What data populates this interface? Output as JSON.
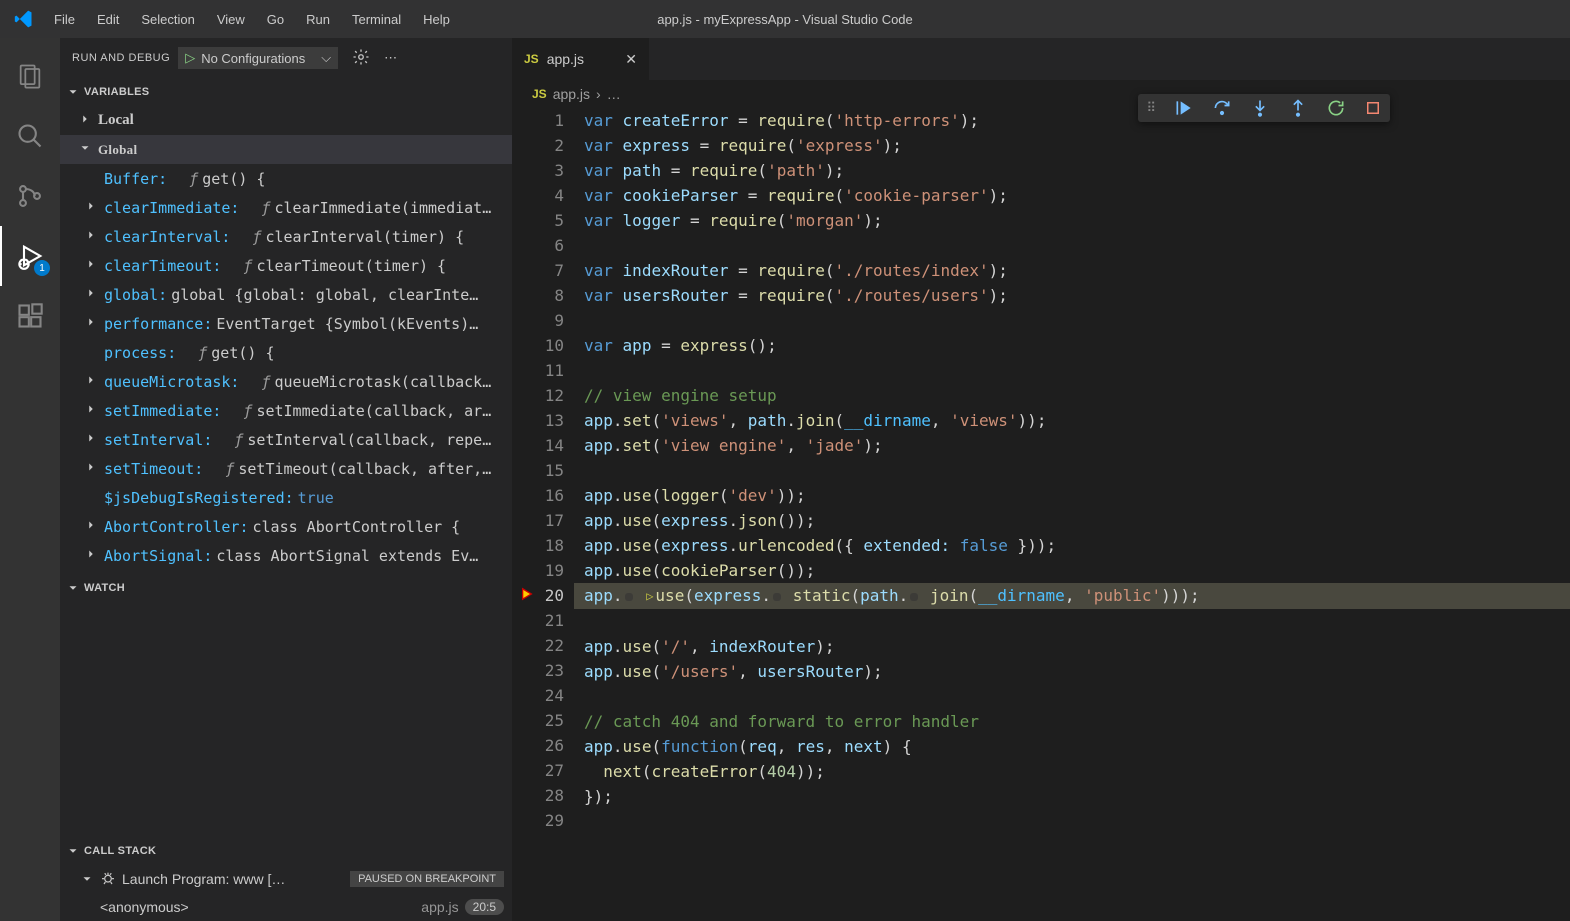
{
  "titlebar": {
    "title": "app.js - myExpressApp - Visual Studio Code",
    "menu": [
      "File",
      "Edit",
      "Selection",
      "View",
      "Go",
      "Run",
      "Terminal",
      "Help"
    ]
  },
  "activitybar": {
    "active_index": 3,
    "debug_badge": "1"
  },
  "sidebar": {
    "title": "RUN AND DEBUG",
    "config_label": "No Configurations",
    "sections": {
      "variables": "VARIABLES",
      "watch": "WATCH",
      "callstack": "CALL STACK"
    },
    "scopes": {
      "local": "Local",
      "global": "Global"
    },
    "global_vars": [
      {
        "expand": false,
        "name": "Buffer:",
        "func": true,
        "value": "get() {"
      },
      {
        "expand": true,
        "name": "clearImmediate:",
        "func": true,
        "value": "clearImmediate(immediat…"
      },
      {
        "expand": true,
        "name": "clearInterval:",
        "func": true,
        "value": "clearInterval(timer) {"
      },
      {
        "expand": true,
        "name": "clearTimeout:",
        "func": true,
        "value": "clearTimeout(timer) {"
      },
      {
        "expand": true,
        "name": "global:",
        "func": false,
        "value": "global {global: global, clearInte…"
      },
      {
        "expand": true,
        "name": "performance:",
        "func": false,
        "value": "EventTarget {Symbol(kEvents)…"
      },
      {
        "expand": false,
        "name": "process:",
        "func": true,
        "value": "get() {"
      },
      {
        "expand": true,
        "name": "queueMicrotask:",
        "func": true,
        "value": "queueMicrotask(callback…"
      },
      {
        "expand": true,
        "name": "setImmediate:",
        "func": true,
        "value": "setImmediate(callback, ar…"
      },
      {
        "expand": true,
        "name": "setInterval:",
        "func": true,
        "value": "setInterval(callback, repe…"
      },
      {
        "expand": true,
        "name": "setTimeout:",
        "func": true,
        "value": "setTimeout(callback, after,…"
      },
      {
        "expand": false,
        "name": "$jsDebugIsRegistered:",
        "func": false,
        "bool": true,
        "value": "true"
      },
      {
        "expand": true,
        "name": "AbortController:",
        "func": false,
        "value": "class AbortController {"
      },
      {
        "expand": true,
        "name": "AbortSignal:",
        "func": false,
        "value": "class AbortSignal extends Ev…"
      }
    ],
    "callstack": {
      "program": "Launch Program: www […",
      "status": "PAUSED ON BREAKPOINT",
      "frame": "<anonymous>",
      "file": "app.js",
      "pos": "20:5"
    }
  },
  "editor": {
    "tab_file": "app.js",
    "breadcrumb_file": "app.js",
    "breadcrumb_rest": "…",
    "current_line": 20,
    "lines": [
      {
        "n": 1,
        "html": "<span class='tok-kw'>var</span> <span class='tok-var'>createError</span> = <span class='tok-fn'>require</span>(<span class='tok-str'>'http-errors'</span>);"
      },
      {
        "n": 2,
        "html": "<span class='tok-kw'>var</span> <span class='tok-var'>express</span> = <span class='tok-fn'>require</span>(<span class='tok-str'>'express'</span>);"
      },
      {
        "n": 3,
        "html": "<span class='tok-kw'>var</span> <span class='tok-var'>path</span> = <span class='tok-fn'>require</span>(<span class='tok-str'>'path'</span>);"
      },
      {
        "n": 4,
        "html": "<span class='tok-kw'>var</span> <span class='tok-var'>cookieParser</span> = <span class='tok-fn'>require</span>(<span class='tok-str'>'cookie-parser'</span>);"
      },
      {
        "n": 5,
        "html": "<span class='tok-kw'>var</span> <span class='tok-var'>logger</span> = <span class='tok-fn'>require</span>(<span class='tok-str'>'morgan'</span>);"
      },
      {
        "n": 6,
        "html": ""
      },
      {
        "n": 7,
        "html": "<span class='tok-kw'>var</span> <span class='tok-var'>indexRouter</span> = <span class='tok-fn'>require</span>(<span class='tok-str'>'./routes/index'</span>);"
      },
      {
        "n": 8,
        "html": "<span class='tok-kw'>var</span> <span class='tok-var'>usersRouter</span> = <span class='tok-fn'>require</span>(<span class='tok-str'>'./routes/users'</span>);"
      },
      {
        "n": 9,
        "html": ""
      },
      {
        "n": 10,
        "html": "<span class='tok-kw'>var</span> <span class='tok-var'>app</span> = <span class='tok-fn'>express</span>();"
      },
      {
        "n": 11,
        "html": ""
      },
      {
        "n": 12,
        "html": "<span class='tok-cmt'>// view engine setup</span>"
      },
      {
        "n": 13,
        "html": "<span class='tok-var'>app</span>.<span class='tok-fn'>set</span>(<span class='tok-str'>'views'</span>, <span class='tok-var'>path</span>.<span class='tok-fn'>join</span>(<span class='tok-const'>__dirname</span>, <span class='tok-str'>'views'</span>));"
      },
      {
        "n": 14,
        "html": "<span class='tok-var'>app</span>.<span class='tok-fn'>set</span>(<span class='tok-str'>'view engine'</span>, <span class='tok-str'>'jade'</span>);"
      },
      {
        "n": 15,
        "html": ""
      },
      {
        "n": 16,
        "html": "<span class='tok-var'>app</span>.<span class='tok-fn'>use</span>(<span class='tok-fn'>logger</span>(<span class='tok-str'>'dev'</span>));"
      },
      {
        "n": 17,
        "html": "<span class='tok-var'>app</span>.<span class='tok-fn'>use</span>(<span class='tok-var'>express</span>.<span class='tok-fn'>json</span>());"
      },
      {
        "n": 18,
        "html": "<span class='tok-var'>app</span>.<span class='tok-fn'>use</span>(<span class='tok-var'>express</span>.<span class='tok-fn'>urlencoded</span>({ <span class='tok-prop'>extended:</span> <span class='tok-kw'>false</span> }));"
      },
      {
        "n": 19,
        "html": "<span class='tok-var'>app</span>.<span class='tok-fn'>use</span>(<span class='tok-fn'>cookieParser</span>());"
      },
      {
        "n": 20,
        "html": "<span class='tok-var'>app</span>.<span class='inline-hint'></span> <span class='hint-play'>▷</span><span class='tok-fn'>use</span>(<span class='tok-var'>express</span>.<span class='inline-hint'></span> <span class='tok-fn'>static</span>(<span class='tok-var'>path</span>.<span class='inline-hint'></span> <span class='tok-fn'>join</span>(<span class='tok-const'>__dirname</span>, <span class='tok-str'>'public'</span>)));",
        "hl": true
      },
      {
        "n": 21,
        "html": ""
      },
      {
        "n": 22,
        "html": "<span class='tok-var'>app</span>.<span class='tok-fn'>use</span>(<span class='tok-str'>'/'</span>, <span class='tok-var'>indexRouter</span>);"
      },
      {
        "n": 23,
        "html": "<span class='tok-var'>app</span>.<span class='tok-fn'>use</span>(<span class='tok-str'>'/users'</span>, <span class='tok-var'>usersRouter</span>);"
      },
      {
        "n": 24,
        "html": ""
      },
      {
        "n": 25,
        "html": "<span class='tok-cmt'>// catch 404 and forward to error handler</span>"
      },
      {
        "n": 26,
        "html": "<span class='tok-var'>app</span>.<span class='tok-fn'>use</span>(<span class='tok-kw'>function</span>(<span class='tok-var'>req</span>, <span class='tok-var'>res</span>, <span class='tok-var'>next</span>) {"
      },
      {
        "n": 27,
        "html": "  <span class='tok-fn'>next</span>(<span class='tok-fn'>createError</span>(<span class='tok-num'>404</span>));"
      },
      {
        "n": 28,
        "html": "});"
      },
      {
        "n": 29,
        "html": ""
      }
    ]
  }
}
